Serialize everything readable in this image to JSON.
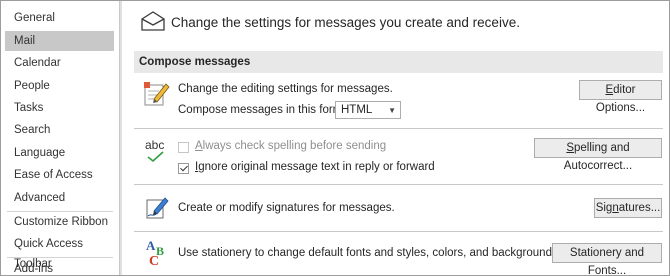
{
  "sidebar": {
    "items": [
      {
        "label": "General"
      },
      {
        "label": "Mail"
      },
      {
        "label": "Calendar"
      },
      {
        "label": "People"
      },
      {
        "label": "Tasks"
      },
      {
        "label": "Search"
      },
      {
        "label": "Language"
      },
      {
        "label": "Ease of Access"
      },
      {
        "label": "Advanced"
      },
      {
        "label": "Customize Ribbon"
      },
      {
        "label": "Quick Access Toolbar"
      },
      {
        "label": "Add-ins"
      }
    ],
    "selected": "Mail"
  },
  "header": {
    "text": "Change the settings for messages you create and receive.",
    "icon": "envelope-icon"
  },
  "compose": {
    "section_title": "Compose messages",
    "editing_text": "Change the editing settings for messages.",
    "editor_options_label": "Editor Options...",
    "format_label": "Compose messages in this format:",
    "format_value": "HTML",
    "abc_label": "abc"
  },
  "spelling": {
    "always_check_label": "Always check spelling before sending",
    "always_check_checked": false,
    "ignore_original_label": "Ignore original message text in reply or forward",
    "ignore_original_checked": true,
    "button_label": "Spelling and Autocorrect..."
  },
  "signatures": {
    "text": "Create or modify signatures for messages.",
    "button_label": "Signatures..."
  },
  "stationery": {
    "text": "Use stationery to change default fonts and styles, colors, and backgrounds.",
    "button_label": "Stationery and Fonts..."
  }
}
